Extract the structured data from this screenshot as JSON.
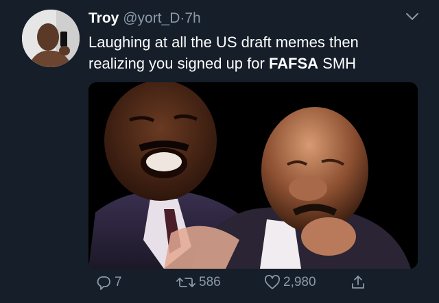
{
  "tweet": {
    "display_name": "Troy",
    "handle": "@yort_D",
    "separator": "·",
    "time": "7h",
    "text_before_bold": "Laughing at all the US draft memes then realizing you signed up for ",
    "text_bold": "FAFSA",
    "text_after_bold": " SMH"
  },
  "actions": {
    "reply_count": "7",
    "retweet_count": "586",
    "like_count": "2,980"
  },
  "icons": {
    "avatar": "avatar-photo",
    "menu": "chevron-down-icon",
    "reply": "reply-icon",
    "retweet": "retweet-icon",
    "like": "heart-icon",
    "share": "share-icon"
  },
  "colors": {
    "background": "#151e29",
    "text": "#ffffff",
    "secondary": "#8a99a8"
  }
}
